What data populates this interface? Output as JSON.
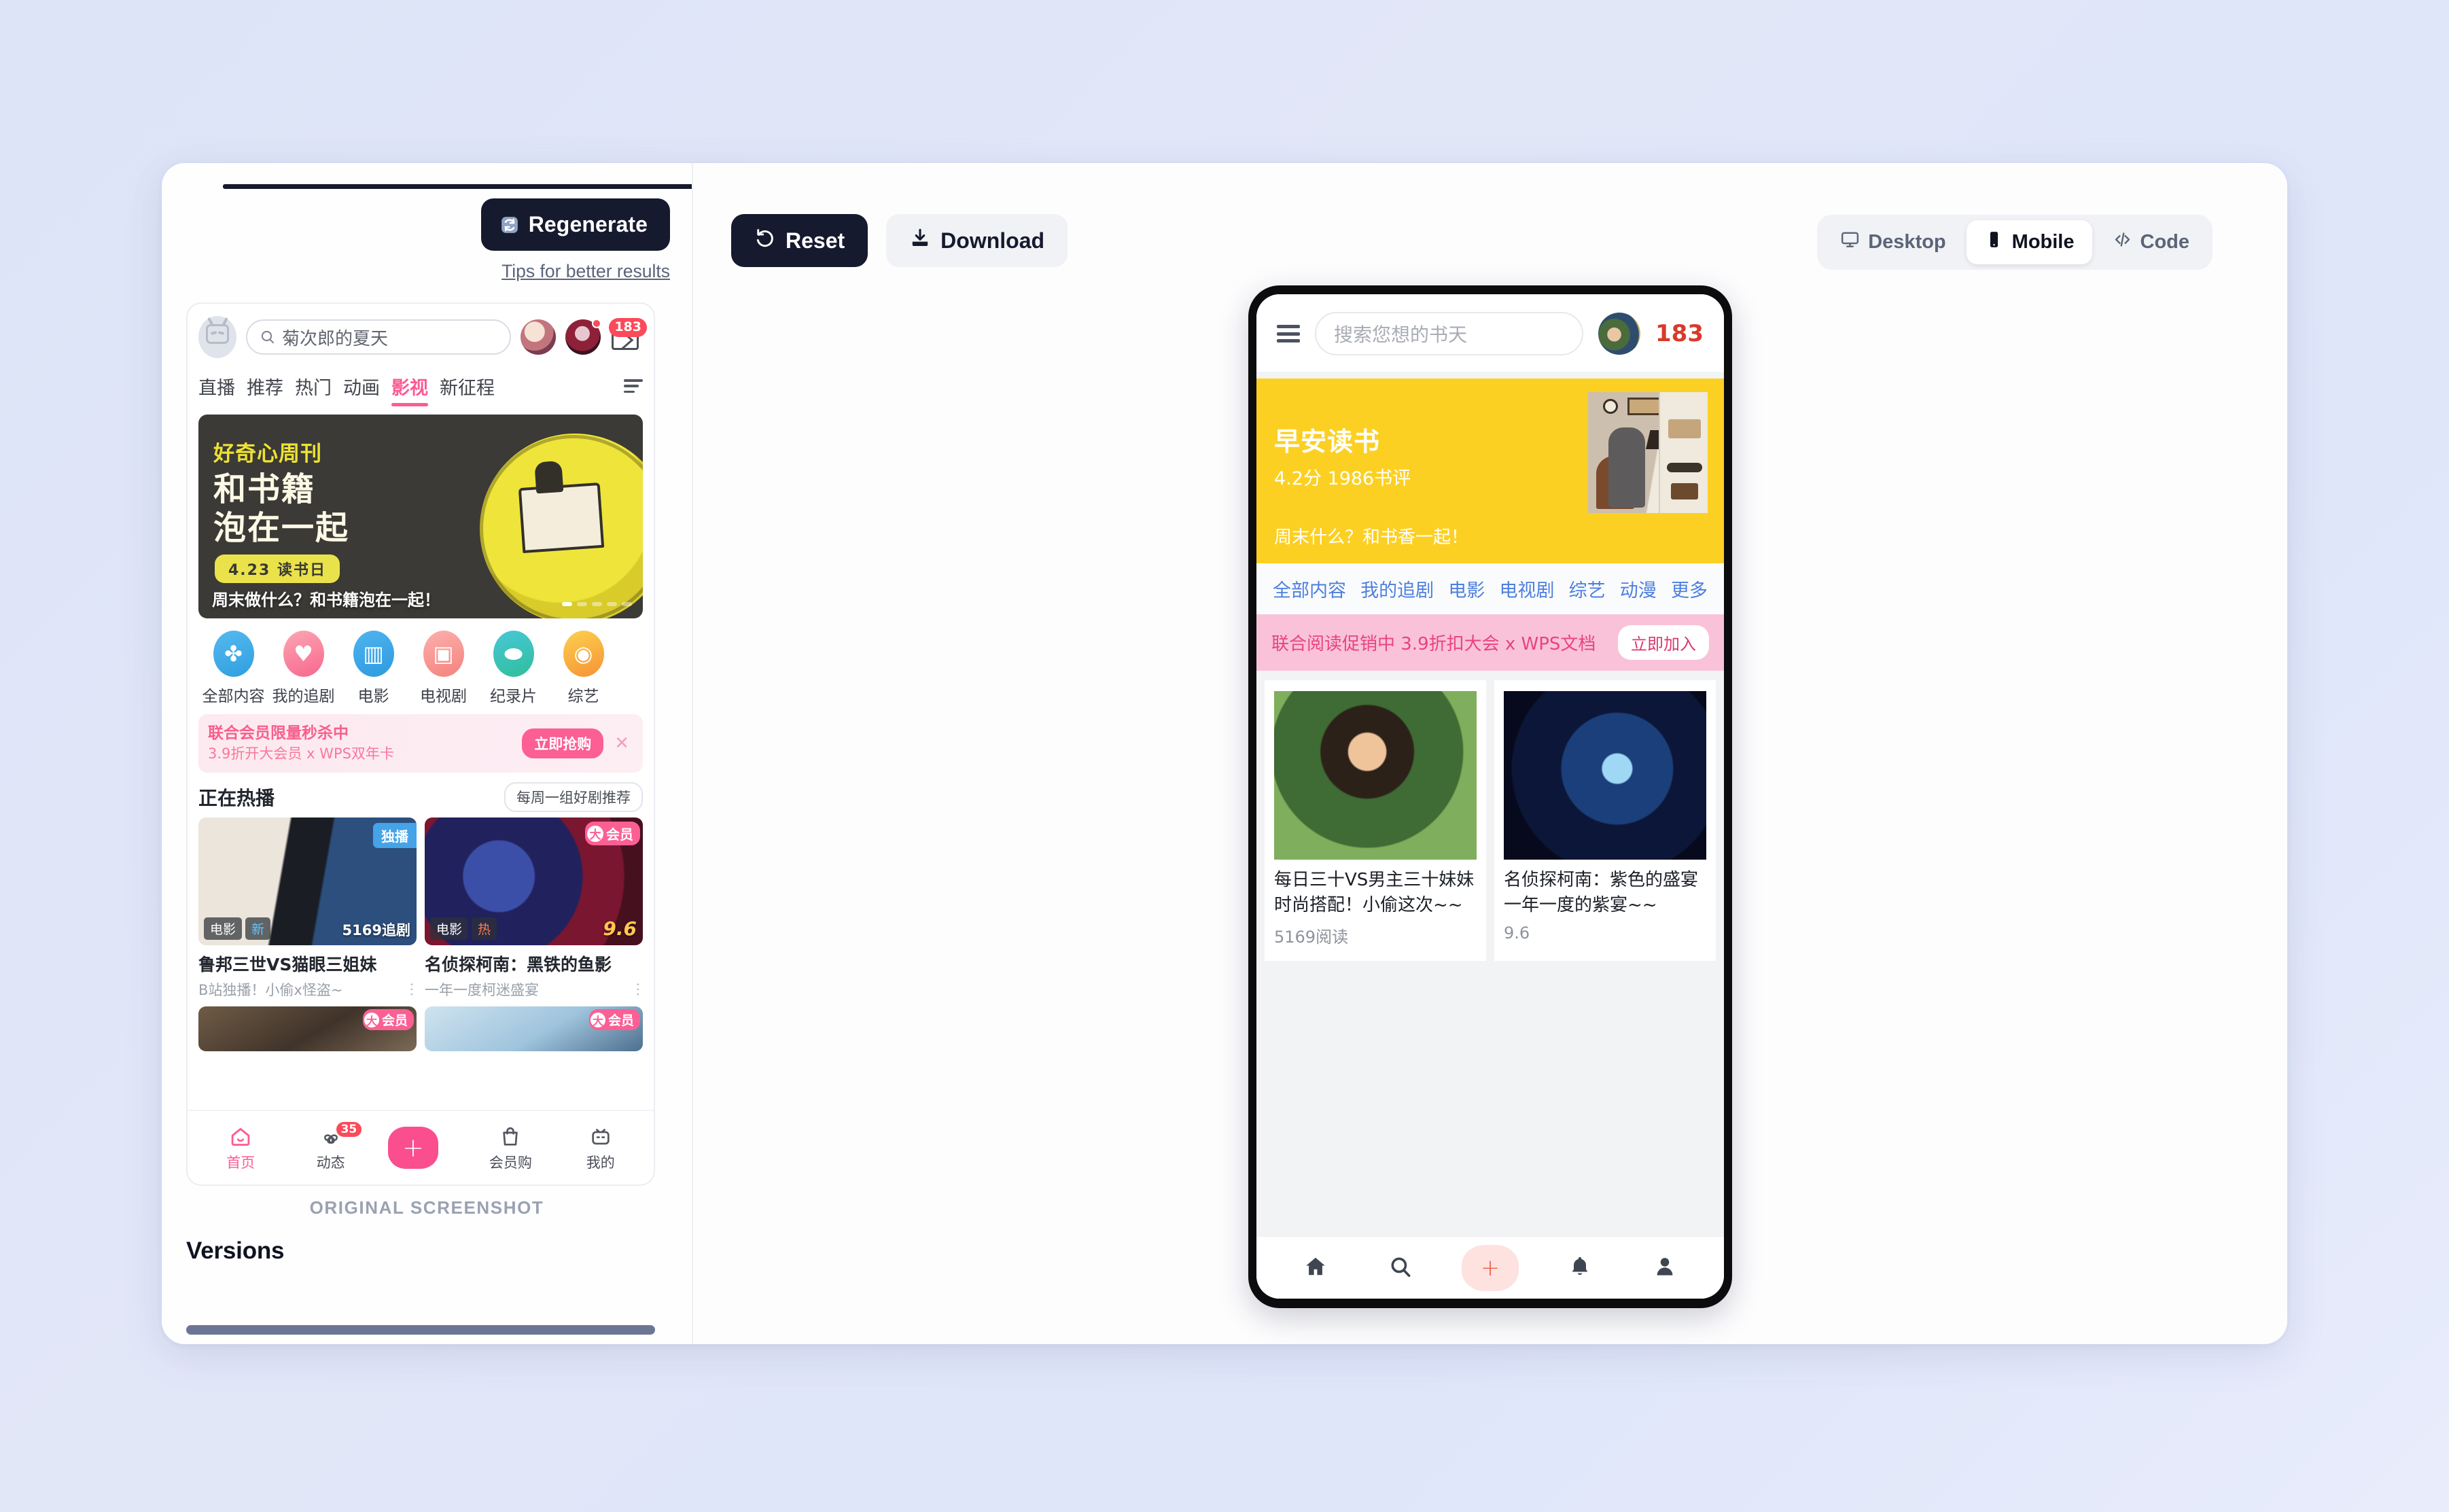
{
  "left_panel": {
    "regenerate_label": "Regenerate",
    "regenerate_icon": "refresh-icon",
    "tips_link": "Tips for better results",
    "original_caption": "ORIGINAL SCREENSHOT",
    "versions_title": "Versions"
  },
  "original_screenshot": {
    "search_value": "菊次郎的夏天",
    "mail_badge": "183",
    "tabs": [
      {
        "label": "直播",
        "active": false
      },
      {
        "label": "推荐",
        "active": false
      },
      {
        "label": "热门",
        "active": false
      },
      {
        "label": "动画",
        "active": false
      },
      {
        "label": "影视",
        "active": true
      },
      {
        "label": "新征程",
        "active": false
      }
    ],
    "banner": {
      "kicker": "好奇心周刊",
      "headline_line1": "和书籍",
      "headline_line2": "泡在一起",
      "pill": "4.23 读书日",
      "caption": "周末做什么？和书籍泡在一起！"
    },
    "categories": [
      {
        "label": "全部内容",
        "glyph": "✤"
      },
      {
        "label": "我的追剧",
        "glyph": "♥"
      },
      {
        "label": "电影",
        "glyph": "▥"
      },
      {
        "label": "电视剧",
        "glyph": "▣"
      },
      {
        "label": "纪录片",
        "glyph": "⬬"
      },
      {
        "label": "综艺",
        "glyph": "◉"
      }
    ],
    "promo": {
      "line1": "联合会员限量秒杀中",
      "line2": "3.9折开大会员 x WPS双年卡",
      "button": "立即抢购",
      "close": "✕"
    },
    "hot_section": {
      "title": "正在热播",
      "more_label": "每周一组好剧推荐",
      "cards": [
        {
          "title": "鲁邦三世VS猫眼三姐妹",
          "subtitle": "B站独播！小偷x怪盗~",
          "corner_tag": "独播",
          "badge_type": "电影",
          "badge_flag": "新",
          "right_text": "5169追剧"
        },
        {
          "title": "名侦探柯南：黑铁的鱼影",
          "subtitle": "一年一度柯迷盛宴",
          "vip_mark": "大",
          "vip_text": "会员",
          "badge_type": "电影",
          "badge_flag": "热",
          "right_text": "9.6"
        }
      ],
      "mini_cards": [
        {
          "vip_mark": "大",
          "vip_text": "会员"
        },
        {
          "vip_mark": "大",
          "vip_text": "会员"
        }
      ]
    },
    "bottom_nav": [
      {
        "label": "首页",
        "icon": "home-icon",
        "active": true,
        "badge": ""
      },
      {
        "label": "动态",
        "icon": "dynamic-icon",
        "active": false,
        "badge": "35"
      },
      {
        "label": "",
        "icon": "plus-icon",
        "active": false,
        "badge": ""
      },
      {
        "label": "会员购",
        "icon": "shop-bag-icon",
        "active": false,
        "badge": ""
      },
      {
        "label": "我的",
        "icon": "profile-tv-icon",
        "active": false,
        "badge": ""
      }
    ]
  },
  "toolbar": {
    "reset_label": "Reset",
    "reset_icon": "undo-icon",
    "download_label": "Download",
    "download_icon": "download-icon",
    "views": [
      {
        "label": "Desktop",
        "icon": "monitor-icon",
        "active": false
      },
      {
        "label": "Mobile",
        "icon": "phone-icon",
        "active": true
      },
      {
        "label": "Code",
        "icon": "code-icon",
        "active": false
      }
    ]
  },
  "preview": {
    "header": {
      "menu_icon": "hamburger-icon",
      "search_placeholder": "搜索您想的书天",
      "avatar": "user-avatar",
      "count": "183"
    },
    "hero": {
      "title": "早安读书",
      "meta": "4.2分 1986书评",
      "tagline": "周末什么？和书香一起！",
      "bg_color": "#fcd022"
    },
    "tabs": [
      "全部内容",
      "我的追剧",
      "电影",
      "电视剧",
      "综艺",
      "动漫",
      "更多"
    ],
    "promo": {
      "text": "联合阅读促销中 3.9折扣大会 x WPS文档",
      "button": "立即加入",
      "bg_color": "#f9c2d8"
    },
    "cards": [
      {
        "title": "每日三十VS男主三十妹妹",
        "subtitle": "时尚搭配！小偷这次~~",
        "meta": "5169阅读"
      },
      {
        "title": "名侦探柯南：紫色的盛宴",
        "subtitle": "一年一度的紫宴~~",
        "meta": "9.6"
      }
    ],
    "bottom_nav": [
      {
        "icon": "home-icon",
        "label": ""
      },
      {
        "icon": "search-icon",
        "label": ""
      },
      {
        "icon": "plus-icon",
        "label": "+"
      },
      {
        "icon": "bell-icon",
        "label": ""
      },
      {
        "icon": "user-icon",
        "label": ""
      }
    ]
  }
}
